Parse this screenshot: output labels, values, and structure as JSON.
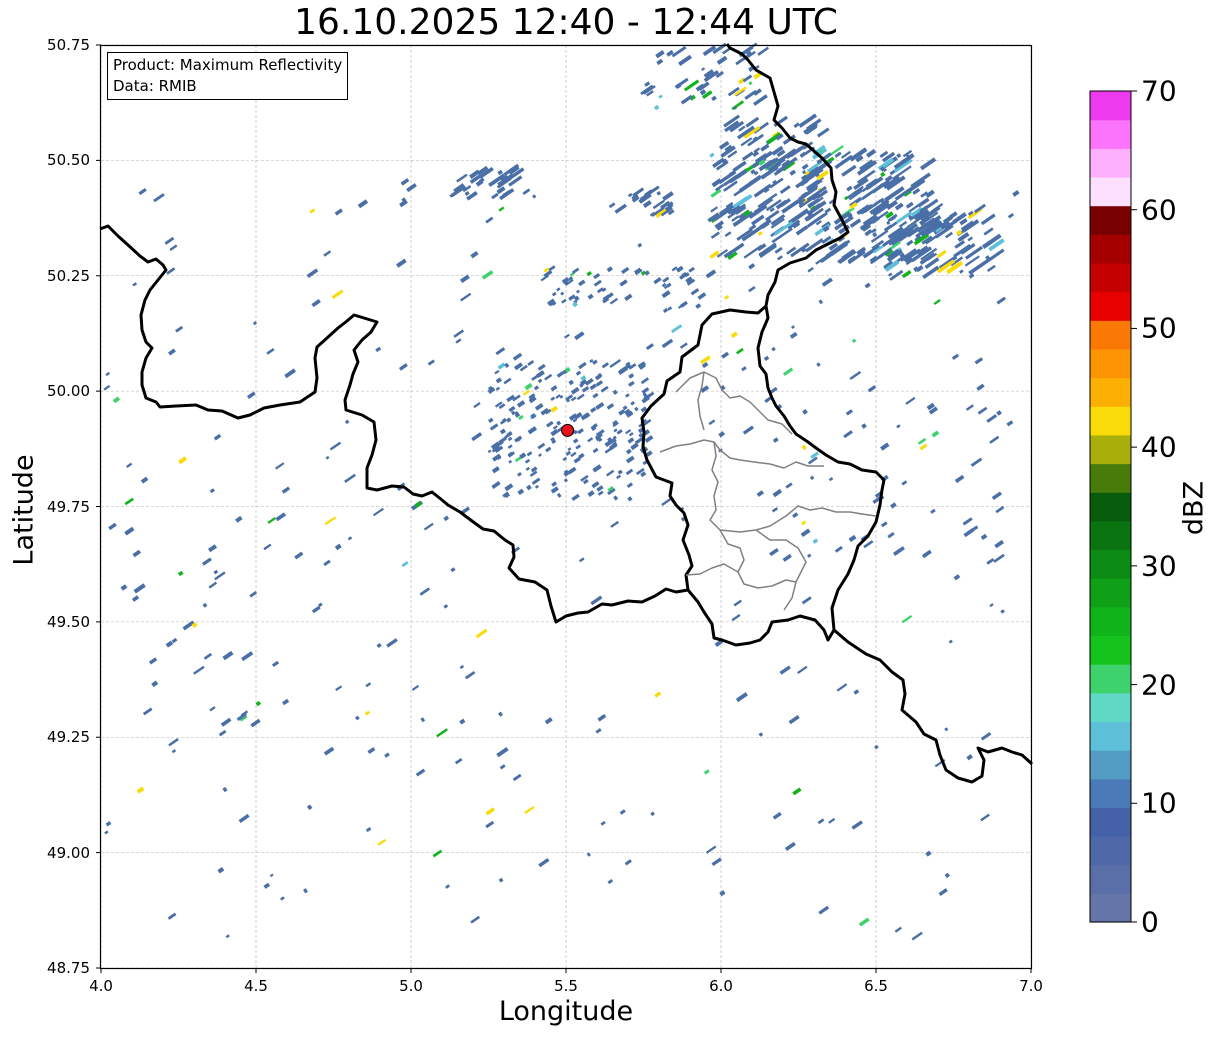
{
  "title": "16.10.2025 12:40 - 12:44 UTC",
  "xlabel": "Longitude",
  "ylabel": "Latitude",
  "info": {
    "product": "Product: Maximum Reflectivity",
    "source": "Data: RMIB"
  },
  "axes": {
    "lon_range": [
      4.0,
      7.0
    ],
    "lat_range": [
      48.75,
      50.75
    ],
    "lon_ticks": [
      "4.0",
      "4.5",
      "5.0",
      "5.5",
      "6.0",
      "6.5",
      "7.0"
    ],
    "lat_ticks": [
      "50.75",
      "50.50",
      "50.25",
      "50.00",
      "49.75",
      "49.50",
      "49.25",
      "49.00",
      "48.75"
    ],
    "grid": "dashed"
  },
  "radar_site": {
    "lon": 5.505,
    "lat": 49.915,
    "color": "#e8121a"
  },
  "colorbar": {
    "label": "dBZ",
    "range": [
      0,
      70
    ],
    "ticks": [
      "0",
      "10",
      "20",
      "30",
      "40",
      "50",
      "60",
      "70"
    ],
    "colors": [
      "#6575a8",
      "#5a6ea8",
      "#4f68a8",
      "#4562a8",
      "#4a7ab8",
      "#529cc4",
      "#5dc0d8",
      "#5fd8c6",
      "#3ed26c",
      "#14c41c",
      "#10b41a",
      "#0fa018",
      "#0c8c14",
      "#0a7410",
      "#075c0c",
      "#487c0a",
      "#a8ae0a",
      "#fadb0a",
      "#fcb004",
      "#fc9404",
      "#fa7804",
      "#e60000",
      "#c40000",
      "#a40000",
      "#780000",
      "#fde0fd",
      "#fdb0fd",
      "#fc74fc",
      "#ee3aee"
    ]
  },
  "radar_echoes": {
    "main_color": "#4a6fa6",
    "secondary_colors": [
      "#10b41a",
      "#3ed26c",
      "#5dc0d8",
      "#fadb0a"
    ]
  }
}
